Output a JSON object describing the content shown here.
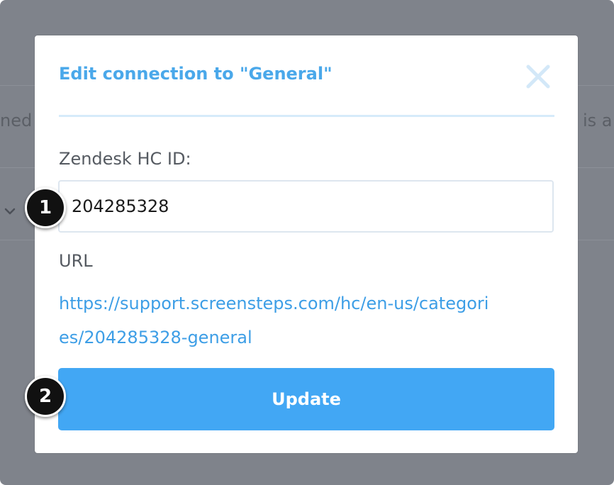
{
  "background": {
    "left_text": "ned",
    "right_text": "is a"
  },
  "modal": {
    "title": "Edit connection to \"General\"",
    "close_icon": "close-icon",
    "hc_id_label": "Zendesk HC ID:",
    "hc_id_value": "204285328",
    "url_label": "URL",
    "url_text": "https://support.screensteps.com/hc/en-us/categories/204285328-general",
    "update_label": "Update"
  },
  "callouts": [
    {
      "label": "1"
    },
    {
      "label": "2"
    }
  ],
  "colors": {
    "accent": "#4aa8ea",
    "button": "#42a7f4",
    "overlay": "#7f838b"
  }
}
